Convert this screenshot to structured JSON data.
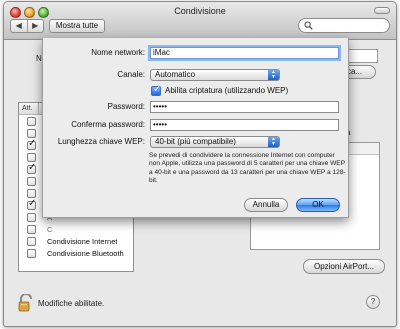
{
  "window": {
    "title": "Condivisione",
    "nav_back": "◀",
    "nav_forward": "▶",
    "show_all_label": "Mostra tutte",
    "search_placeholder": ""
  },
  "background": {
    "computer_name_label": "Nom",
    "edit_button_label": "fica...",
    "services_header_on": "Att.",
    "services_header_service": "S",
    "services": [
      {
        "label": "C",
        "checked": false
      },
      {
        "label": "C",
        "checked": false
      },
      {
        "label": "C",
        "checked": true
      },
      {
        "label": "C",
        "checked": false
      },
      {
        "label": "C",
        "checked": true
      },
      {
        "label": "C",
        "checked": false
      },
      {
        "label": "L",
        "checked": false
      },
      {
        "label": "G",
        "checked": true
      },
      {
        "label": "A",
        "checked": false
      },
      {
        "label": "C",
        "checked": false
      },
      {
        "label": "Condivisione Internet",
        "checked": false
      },
      {
        "label": "Condivisione Bluetooth",
        "checked": false
      }
    ],
    "right_label": "a",
    "airport_button_label": "Opzioni AirPort...",
    "lock_text": "Modifiche abilitate.",
    "help_label": "?"
  },
  "sheet": {
    "network_name_label": "Nome network:",
    "network_name_value": "iMac",
    "channel_label": "Canale:",
    "channel_value": "Automatico",
    "encryption_label": "Abilita criptatura (utilizzando WEP)",
    "encryption_checked": true,
    "password_label": "Password:",
    "password_value": "•••••",
    "confirm_label": "Conferma password:",
    "confirm_value": "•••••",
    "key_length_label": "Lunghezza chiave WEP:",
    "key_length_value": "40-bit (più compatibile)",
    "note": "Se prevedi di condividere la connessione Internet con computer non Apple, utilizza una password di 5 caratteri per una chiave WEP a 40-bit e una password da 13 caratteri per una chiave WEP a 128-bit.",
    "cancel_label": "Annulla",
    "ok_label": "OK"
  }
}
